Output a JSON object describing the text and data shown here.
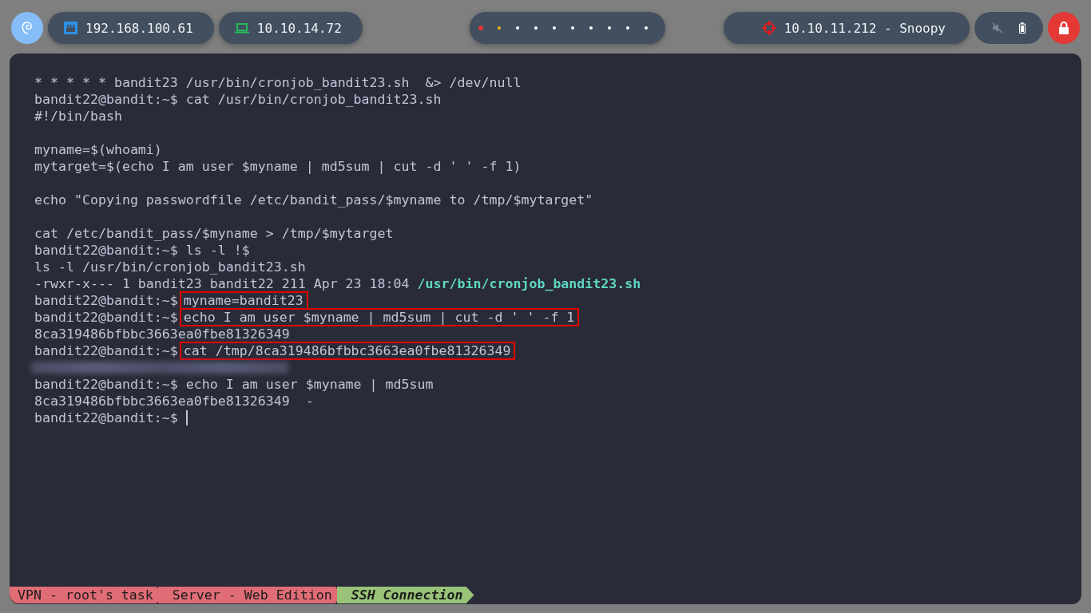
{
  "topbar": {
    "left": [
      {
        "kind": "network",
        "label": "192.168.100.61"
      },
      {
        "kind": "laptop",
        "label": "10.10.14.72"
      }
    ],
    "workspaces": [
      {
        "color": "#e53935",
        "selected": true
      },
      {
        "color": "#f5b40f",
        "selected": false
      },
      {
        "color": "#ffffff",
        "selected": false
      },
      {
        "color": "#ffffff",
        "selected": false
      },
      {
        "color": "#ffffff",
        "selected": false
      },
      {
        "color": "#ffffff",
        "selected": false
      },
      {
        "color": "#ffffff",
        "selected": false
      },
      {
        "color": "#ffffff",
        "selected": false
      },
      {
        "color": "#ffffff",
        "selected": false
      },
      {
        "color": "#ffffff",
        "selected": false
      }
    ],
    "target": "10.10.11.212 - Snoopy"
  },
  "terminal": {
    "lines": [
      {
        "kind": "text",
        "segments": [
          {
            "kind": "plain",
            "text": "* * * * * bandit23 /usr/bin/cronjob_bandit23.sh  &> /dev/null"
          }
        ]
      },
      {
        "kind": "text",
        "segments": [
          {
            "kind": "plain",
            "text": "bandit22@bandit:~$ cat /usr/bin/cronjob_bandit23.sh"
          }
        ]
      },
      {
        "kind": "text",
        "segments": [
          {
            "kind": "plain",
            "text": "#!/bin/bash"
          }
        ]
      },
      {
        "kind": "blank"
      },
      {
        "kind": "text",
        "segments": [
          {
            "kind": "plain",
            "text": "myname=$(whoami)"
          }
        ]
      },
      {
        "kind": "text",
        "segments": [
          {
            "kind": "plain",
            "text": "mytarget=$(echo I am user $myname | md5sum | cut -d ' ' -f 1)"
          }
        ]
      },
      {
        "kind": "blank"
      },
      {
        "kind": "text",
        "segments": [
          {
            "kind": "plain",
            "text": "echo \"Copying passwordfile /etc/bandit_pass/$myname to /tmp/$mytarget\""
          }
        ]
      },
      {
        "kind": "blank"
      },
      {
        "kind": "text",
        "segments": [
          {
            "kind": "plain",
            "text": "cat /etc/bandit_pass/$myname > /tmp/$mytarget"
          }
        ]
      },
      {
        "kind": "text",
        "segments": [
          {
            "kind": "plain",
            "text": "bandit22@bandit:~$ ls -l !$"
          }
        ]
      },
      {
        "kind": "text",
        "segments": [
          {
            "kind": "plain",
            "text": "ls -l /usr/bin/cronjob_bandit23.sh"
          }
        ]
      },
      {
        "kind": "text",
        "segments": [
          {
            "kind": "plain",
            "text": "-rwxr-x--- 1 bandit23 bandit22 211 Apr 23 18:04 "
          },
          {
            "kind": "path",
            "text": "/usr/bin/cronjob_bandit23.sh"
          }
        ]
      },
      {
        "kind": "text",
        "segments": [
          {
            "kind": "plain",
            "text": "bandit22@bandit:~$ "
          },
          {
            "kind": "boxed",
            "text": "myname=bandit23"
          }
        ]
      },
      {
        "kind": "text",
        "segments": [
          {
            "kind": "plain",
            "text": "bandit22@bandit:~$ "
          },
          {
            "kind": "boxed",
            "text": "echo I am user $myname | md5sum | cut -d ' ' -f 1"
          }
        ]
      },
      {
        "kind": "text",
        "segments": [
          {
            "kind": "plain",
            "text": "8ca319486bfbbc3663ea0fbe81326349"
          }
        ]
      },
      {
        "kind": "text",
        "segments": [
          {
            "kind": "plain",
            "text": "bandit22@bandit:~$ "
          },
          {
            "kind": "boxed",
            "text": "cat /tmp/8ca319486bfbbc3663ea0fbe81326349"
          }
        ]
      },
      {
        "kind": "redacted"
      },
      {
        "kind": "text",
        "segments": [
          {
            "kind": "plain",
            "text": "bandit22@bandit:~$ echo I am user $myname | md5sum"
          }
        ]
      },
      {
        "kind": "text",
        "segments": [
          {
            "kind": "plain",
            "text": "8ca319486bfbbc3663ea0fbe81326349  -"
          }
        ]
      },
      {
        "kind": "prompt",
        "segments": [
          {
            "kind": "plain",
            "text": "bandit22@bandit:~$ "
          }
        ]
      }
    ],
    "status": [
      {
        "label": "VPN - root's task",
        "color": "#e06c75",
        "emphasis": false
      },
      {
        "label": "Server - Web Edition",
        "color": "#e06c75",
        "emphasis": false
      },
      {
        "label": "SSH Connection",
        "color": "#98c379",
        "emphasis": true
      }
    ]
  }
}
